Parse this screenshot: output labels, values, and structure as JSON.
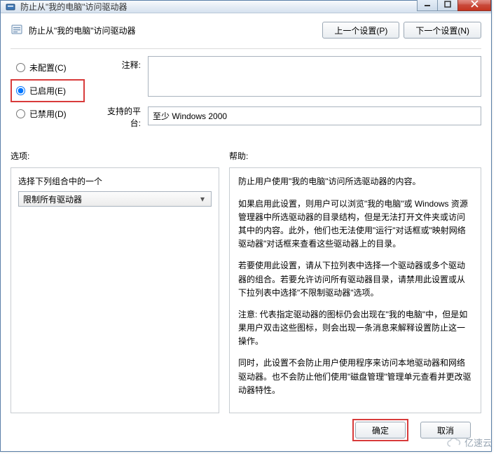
{
  "titlebar": {
    "text": "防止从\"我的电脑\"访问驱动器"
  },
  "header": {
    "title": "防止从\"我的电脑\"访问驱动器",
    "prev_btn": "上一个设置(P)",
    "next_btn": "下一个设置(N)"
  },
  "radios": {
    "not_configured": "未配置(C)",
    "enabled": "已启用(E)",
    "disabled": "已禁用(D)"
  },
  "fields": {
    "comment_label": "注释:",
    "comment_value": "",
    "platform_label": "支持的平台:",
    "platform_value": "至少 Windows 2000"
  },
  "panels": {
    "options_label": "选项:",
    "help_label": "帮助:"
  },
  "options": {
    "prompt": "选择下列组合中的一个",
    "dropdown_value": "限制所有驱动器"
  },
  "help": {
    "p1": "防止用户使用\"我的电脑\"访问所选驱动器的内容。",
    "p2": "如果启用此设置，则用户可以浏览\"我的电脑\"或 Windows 资源管理器中所选驱动器的目录结构，但是无法打开文件夹或访问其中的内容。此外，他们也无法使用\"运行\"对话框或\"映射网络驱动器\"对话框来查看这些驱动器上的目录。",
    "p3": "若要使用此设置，请从下拉列表中选择一个驱动器或多个驱动器的组合。若要允许访问所有驱动器目录，请禁用此设置或从下拉列表中选择\"不限制驱动器\"选项。",
    "p4": "注意: 代表指定驱动器的图标仍会出现在\"我的电脑\"中，但是如果用户双击这些图标，则会出现一条消息来解释设置防止这一操作。",
    "p5": "同时，此设置不会防止用户使用程序来访问本地驱动器和网络驱动器。也不会防止他们使用\"磁盘管理\"管理单元查看并更改驱动器特性。"
  },
  "footer": {
    "ok": "确定",
    "cancel": "取消"
  },
  "watermark": "亿速云"
}
